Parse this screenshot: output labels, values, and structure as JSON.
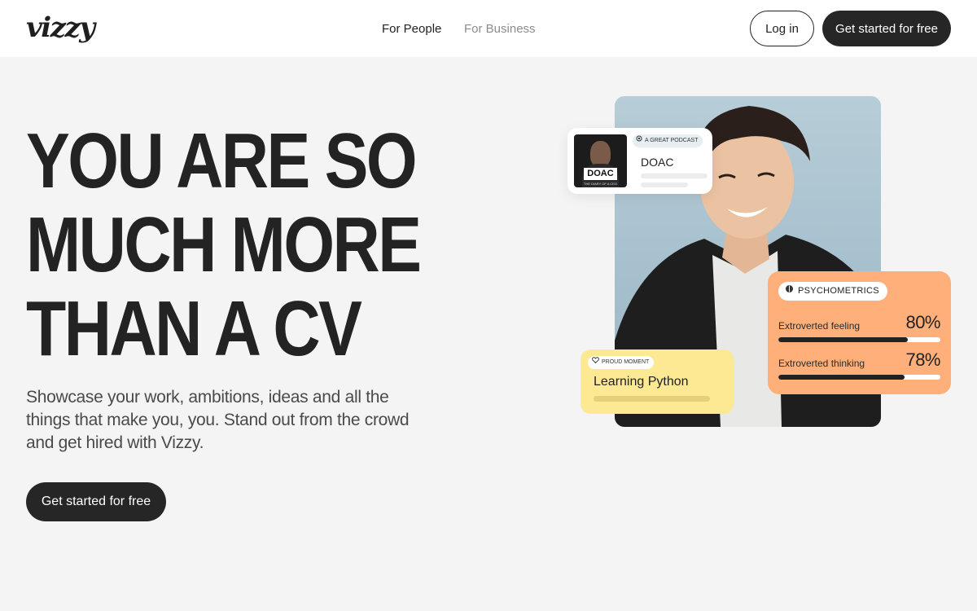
{
  "header": {
    "logo": "vizzy",
    "nav": [
      {
        "label": "For People"
      },
      {
        "label": "For Business"
      }
    ],
    "login_label": "Log in",
    "cta_label": "Get started for free"
  },
  "hero": {
    "title_lines": [
      "YOU ARE SO",
      "MUCH MORE",
      "THAN A CV"
    ],
    "subtitle": "Showcase your work, ambitions, ideas and all the things that make you, you. Stand out from the crowd and get hired with Vizzy.",
    "cta_label": "Get started for free"
  },
  "podcast_card": {
    "badge": "A GREAT PODCAST",
    "title": "DOAC",
    "thumb_text": "DOAC",
    "thumb_caption": "THE DIARY OF A CEO"
  },
  "psychometrics_card": {
    "badge": "PSYCHOMETRICS",
    "traits": [
      {
        "label": "Extroverted feeling",
        "value": "80%",
        "fraction": 0.8
      },
      {
        "label": "Extroverted thinking",
        "value": "78%",
        "fraction": 0.78
      }
    ]
  },
  "proud_card": {
    "badge": "PROUD MOMENT",
    "title": "Learning Python"
  },
  "colors": {
    "dark": "#262626",
    "page_bg": "#f4f4f4",
    "psych_bg": "#ffb07a",
    "proud_bg": "#fde994"
  }
}
